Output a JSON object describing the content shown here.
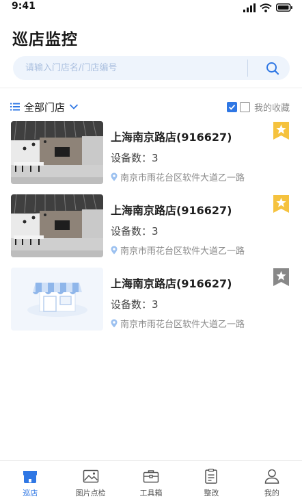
{
  "status_bar": {
    "time": "9:41"
  },
  "page_title": "巡店监控",
  "search": {
    "placeholder": "请输入门店名/门店编号",
    "value": ""
  },
  "filter": {
    "label": "全部门店",
    "favorites_label": "我的收藏"
  },
  "stores": [
    {
      "name": "上海南京路店(916627)",
      "devices": "设备数：3",
      "address": "南京市雨花台区软件大道乙一路",
      "favorited": true,
      "thumb": "interior-photo"
    },
    {
      "name": "上海南京路店(916627)",
      "devices": "设备数：3",
      "address": "南京市雨花台区软件大道乙一路",
      "favorited": true,
      "thumb": "interior-photo"
    },
    {
      "name": "上海南京路店(916627)",
      "devices": "设备数：3",
      "address": "南京市雨花台区软件大道乙一路",
      "favorited": false,
      "thumb": "store-placeholder"
    }
  ],
  "tabs": [
    {
      "label": "巡店",
      "icon": "store-icon",
      "active": true
    },
    {
      "label": "图片点检",
      "icon": "image-icon",
      "active": false
    },
    {
      "label": "工具箱",
      "icon": "toolbox-icon",
      "active": false
    },
    {
      "label": "整改",
      "icon": "clipboard-icon",
      "active": false
    },
    {
      "label": "我的",
      "icon": "user-icon",
      "active": false
    }
  ],
  "colors": {
    "accent": "#2f77e4",
    "star_active": "#f5c23e",
    "star_inactive": "#888888",
    "search_bg": "#eef4fc"
  }
}
